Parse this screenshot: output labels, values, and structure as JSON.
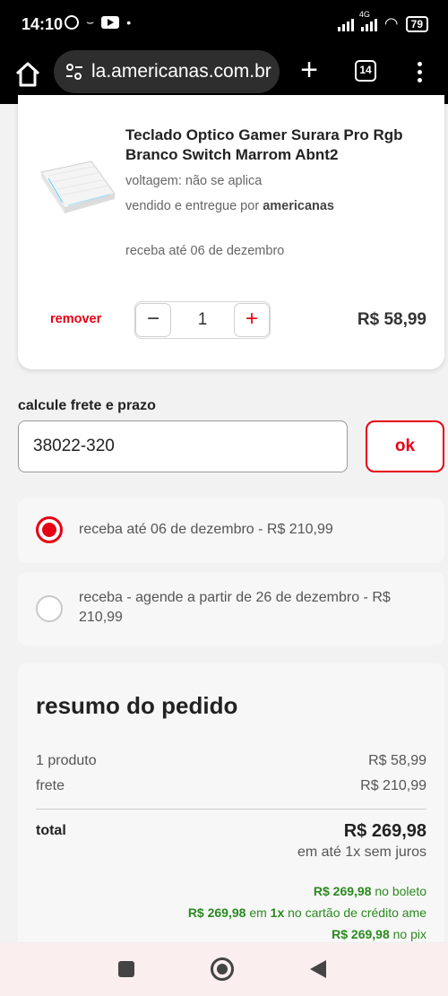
{
  "status_bar": {
    "time": "14:10",
    "network": "4G",
    "battery": "79"
  },
  "browser": {
    "url": "la.americanas.com.br",
    "tab_count": "14"
  },
  "product": {
    "name": "Teclado Optico Gamer Surara Pro Rgb Branco Switch Marrom Abnt2",
    "voltage": "voltagem: não se aplica",
    "seller_prefix": "vendido e entregue por",
    "seller_name": "americanas",
    "delivery": "receba até 06 de dezembro",
    "remove_label": "remover",
    "quantity": "1",
    "minus_label": "−",
    "plus_label": "+",
    "price": "R$ 58,99"
  },
  "shipping": {
    "label": "calcule frete e prazo",
    "cep_value": "38022-320",
    "ok_label": "ok",
    "options": [
      {
        "text": "receba até 06 de dezembro - R$ 210,99",
        "selected": true
      },
      {
        "text": "receba - agende a partir de 26 de dezembro - R$ 210,99",
        "selected": false
      }
    ]
  },
  "summary": {
    "title": "resumo do pedido",
    "products_label": "1 produto",
    "products_value": "R$ 58,99",
    "shipping_label": "frete",
    "shipping_value": "R$ 210,99",
    "total_label": "total",
    "total_value": "R$ 269,98",
    "installment": "em até 1x sem juros",
    "boleto_value": "R$ 269,98",
    "boleto_label": "no boleto",
    "card_value": "R$ 269,98",
    "card_mid": "em",
    "card_times": "1x",
    "card_label": "no cartão de crédito ame",
    "pix_value": "R$ 269,98",
    "pix_label": "no pix"
  },
  "colors": {
    "accent": "#e60014",
    "green": "#2a8a1e"
  },
  "icons": [
    "home-icon",
    "tune-icon",
    "plus-icon",
    "tabs-icon",
    "menu-icon",
    "whatsapp-icon",
    "youtube-icon",
    "wifi-icon",
    "battery-icon"
  ]
}
